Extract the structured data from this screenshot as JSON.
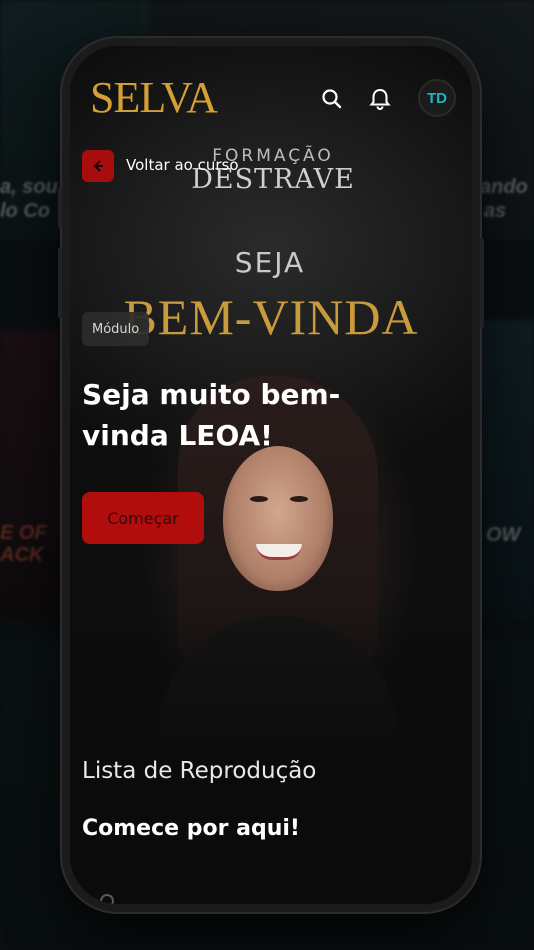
{
  "background": {
    "tiles": [
      {
        "text": "a, sou"
      },
      {
        "text": "lo Co"
      },
      {
        "text": "ando"
      },
      {
        "text": "as"
      },
      {
        "text": "E OF"
      },
      {
        "text": "ACK"
      },
      {
        "text": "OW"
      }
    ]
  },
  "header": {
    "logo_text": "SELVA",
    "search_icon": "search-icon",
    "bell_icon": "bell-icon",
    "avatar_initials": "TD"
  },
  "nav": {
    "back_icon": "arrow-left-icon",
    "back_label": "Voltar ao curso"
  },
  "hero": {
    "banner_line1": "FORMAÇÃO",
    "banner_line2": "DESTRAVE",
    "banner_line3": "SEJA",
    "banner_line4": "BEM-VINDA",
    "badge": "Módulo",
    "title": "Seja muito bem-vinda LEOA!",
    "start_label": "Começar"
  },
  "playlist": {
    "label": "Lista de Reprodução",
    "section_title": "Comece por aqui!"
  },
  "colors": {
    "accent_red": "#b20d0d",
    "logo_gold": "#d4a033",
    "avatar_cyan": "#19b9c9"
  }
}
